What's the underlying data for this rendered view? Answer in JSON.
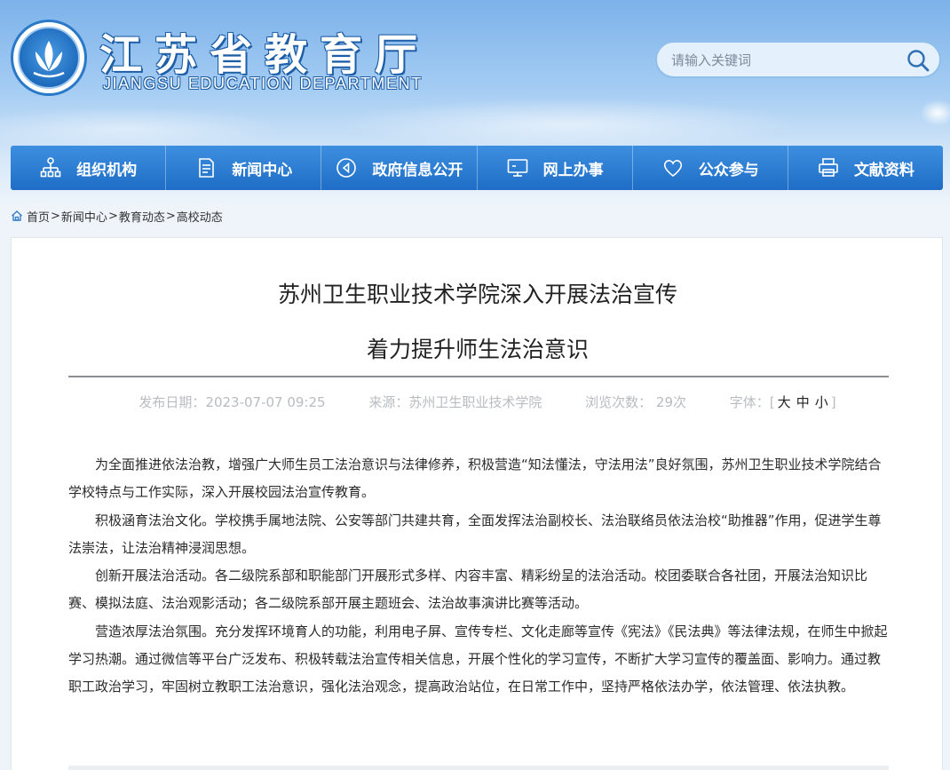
{
  "header": {
    "title": "江苏省教育厅",
    "subtitle": "JIANGSU EDUCATION DEPARTMENT"
  },
  "search": {
    "placeholder": "请输入关键词"
  },
  "nav": {
    "items": [
      {
        "label": "组织机构",
        "icon": "org-chart-icon"
      },
      {
        "label": "新闻中心",
        "icon": "document-icon"
      },
      {
        "label": "政府信息公开",
        "icon": "play-circle-icon"
      },
      {
        "label": "网上办事",
        "icon": "monitor-icon"
      },
      {
        "label": "公众参与",
        "icon": "heart-icon"
      },
      {
        "label": "文献资料",
        "icon": "printer-icon"
      }
    ]
  },
  "breadcrumb": {
    "items": [
      "首页",
      "新闻中心",
      "教育动态",
      "高校动态"
    ],
    "separator": ">"
  },
  "article": {
    "title_line1": "苏州卫生职业技术学院深入开展法治宣传",
    "title_line2": "着力提升师生法治意识",
    "meta": {
      "publish_date": "发布日期：2023-07-07 09:25",
      "source": "来源：苏州卫生职业技术学院",
      "views": "浏览次数： 29次",
      "font_size_label": "字体：",
      "bracket_open": "[",
      "size_large": "大",
      "size_medium": "中",
      "size_small": "小",
      "bracket_close": "]"
    },
    "paragraphs": [
      "为全面推进依法治教，增强广大师生员工法治意识与法律修养，积极营造“知法懂法，守法用法”良好氛围，苏州卫生职业技术学院结合学校特点与工作实际，深入开展校园法治宣传教育。",
      "积极涵育法治文化。学校携手属地法院、公安等部门共建共育，全面发挥法治副校长、法治联络员依法治校“助推器”作用，促进学生尊法崇法，让法治精神浸润思想。",
      "创新开展法治活动。各二级院系部和职能部门开展形式多样、内容丰富、精彩纷呈的法治活动。校团委联合各社团，开展法治知识比赛、模拟法庭、法治观影活动；各二级院系部开展主题班会、法治故事演讲比赛等活动。",
      "营造浓厚法治氛围。充分发挥环境育人的功能，利用电子屏、宣传专栏、文化走廊等宣传《宪法》《民法典》等法律法规，在师生中掀起学习热潮。通过微信等平台广泛发布、积极转载法治宣传相关信息，开展个性化的学习宣传，不断扩大学习宣传的覆盖面、影响力。通过教职工政治学习，牢固树立教职工法治意识，强化法治观念，提高政治站位，在日常工作中，坚持严格依法办学，依法管理、依法执教。"
    ]
  },
  "colors": {
    "nav_top": "#3d8fe0",
    "nav_bottom": "#1f6dc6",
    "title_text": "#222222",
    "meta_text": "#b8bcc1"
  }
}
